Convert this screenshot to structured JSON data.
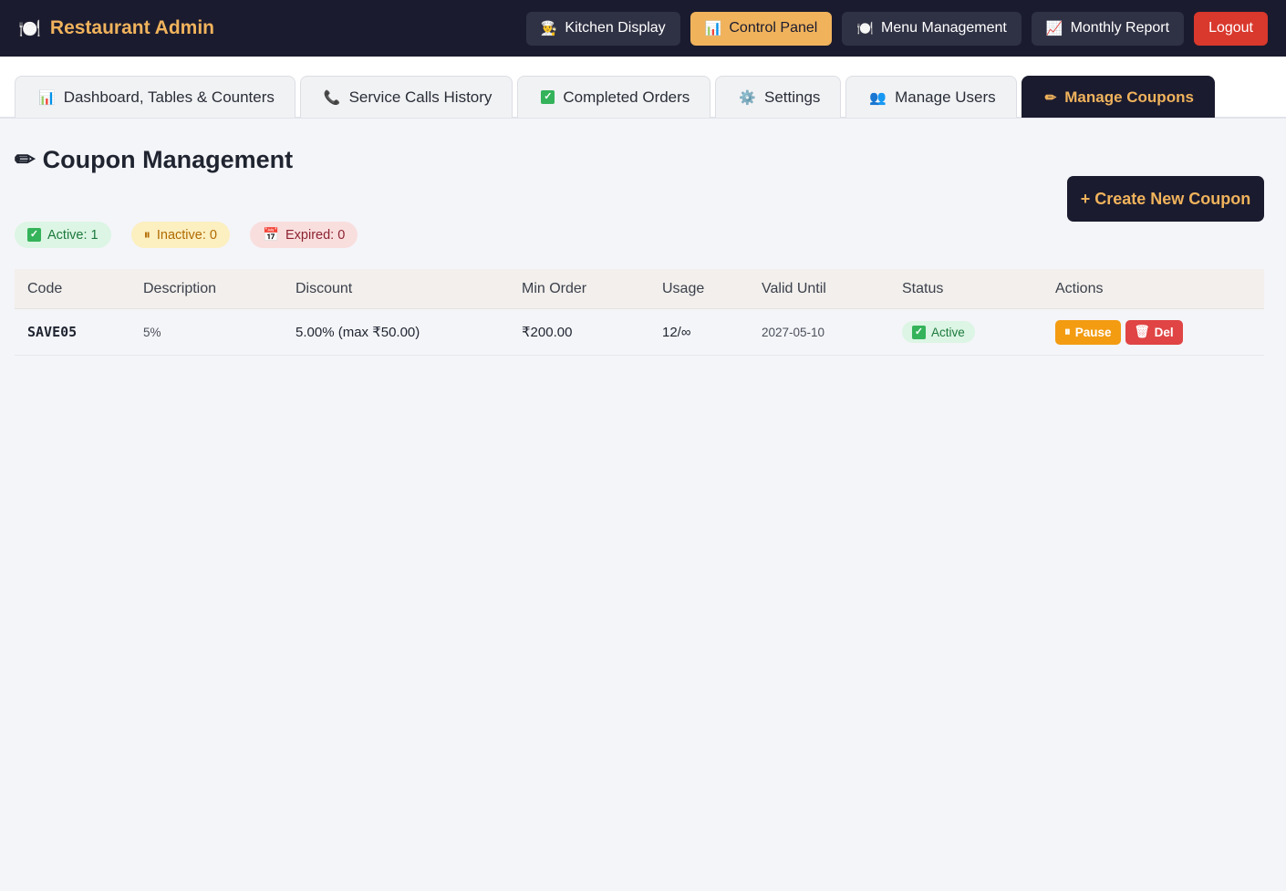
{
  "header": {
    "brand_icon": "🍽️",
    "brand_title": "Restaurant Admin",
    "nav": [
      {
        "icon": "👨‍🍳",
        "label": "Kitchen Display"
      },
      {
        "icon": "📊",
        "label": "Control Panel"
      },
      {
        "icon": "🍽️",
        "label": "Menu Management"
      },
      {
        "icon": "📈",
        "label": "Monthly Report"
      }
    ],
    "logout_label": "Logout"
  },
  "tabs": [
    {
      "icon": "📊",
      "label": "Dashboard, Tables & Counters"
    },
    {
      "icon": "📞",
      "label": "Service Calls History"
    },
    {
      "icon": "✓",
      "label": "Completed Orders"
    },
    {
      "icon": "⚙️",
      "label": "Settings"
    },
    {
      "icon": "👥",
      "label": "Manage Users"
    },
    {
      "icon": "✏",
      "label": "Manage Coupons"
    }
  ],
  "main": {
    "title_icon": "✏",
    "title": "Coupon Management",
    "create_button": "+ Create New Coupon",
    "badges": {
      "active": "Active: 1",
      "inactive": "Inactive: 0",
      "expired": "Expired: 0"
    },
    "table": {
      "headers": [
        "Code",
        "Description",
        "Discount",
        "Min Order",
        "Usage",
        "Valid Until",
        "Status",
        "Actions"
      ],
      "rows": [
        {
          "code": "SAVE05",
          "description": "5%",
          "discount": "5.00% (max ₹50.00)",
          "min_order": "₹200.00",
          "usage": "12/∞",
          "valid_until": "2027-05-10",
          "status": "Active",
          "pause_label": "Pause",
          "del_label": "Del"
        }
      ]
    }
  }
}
